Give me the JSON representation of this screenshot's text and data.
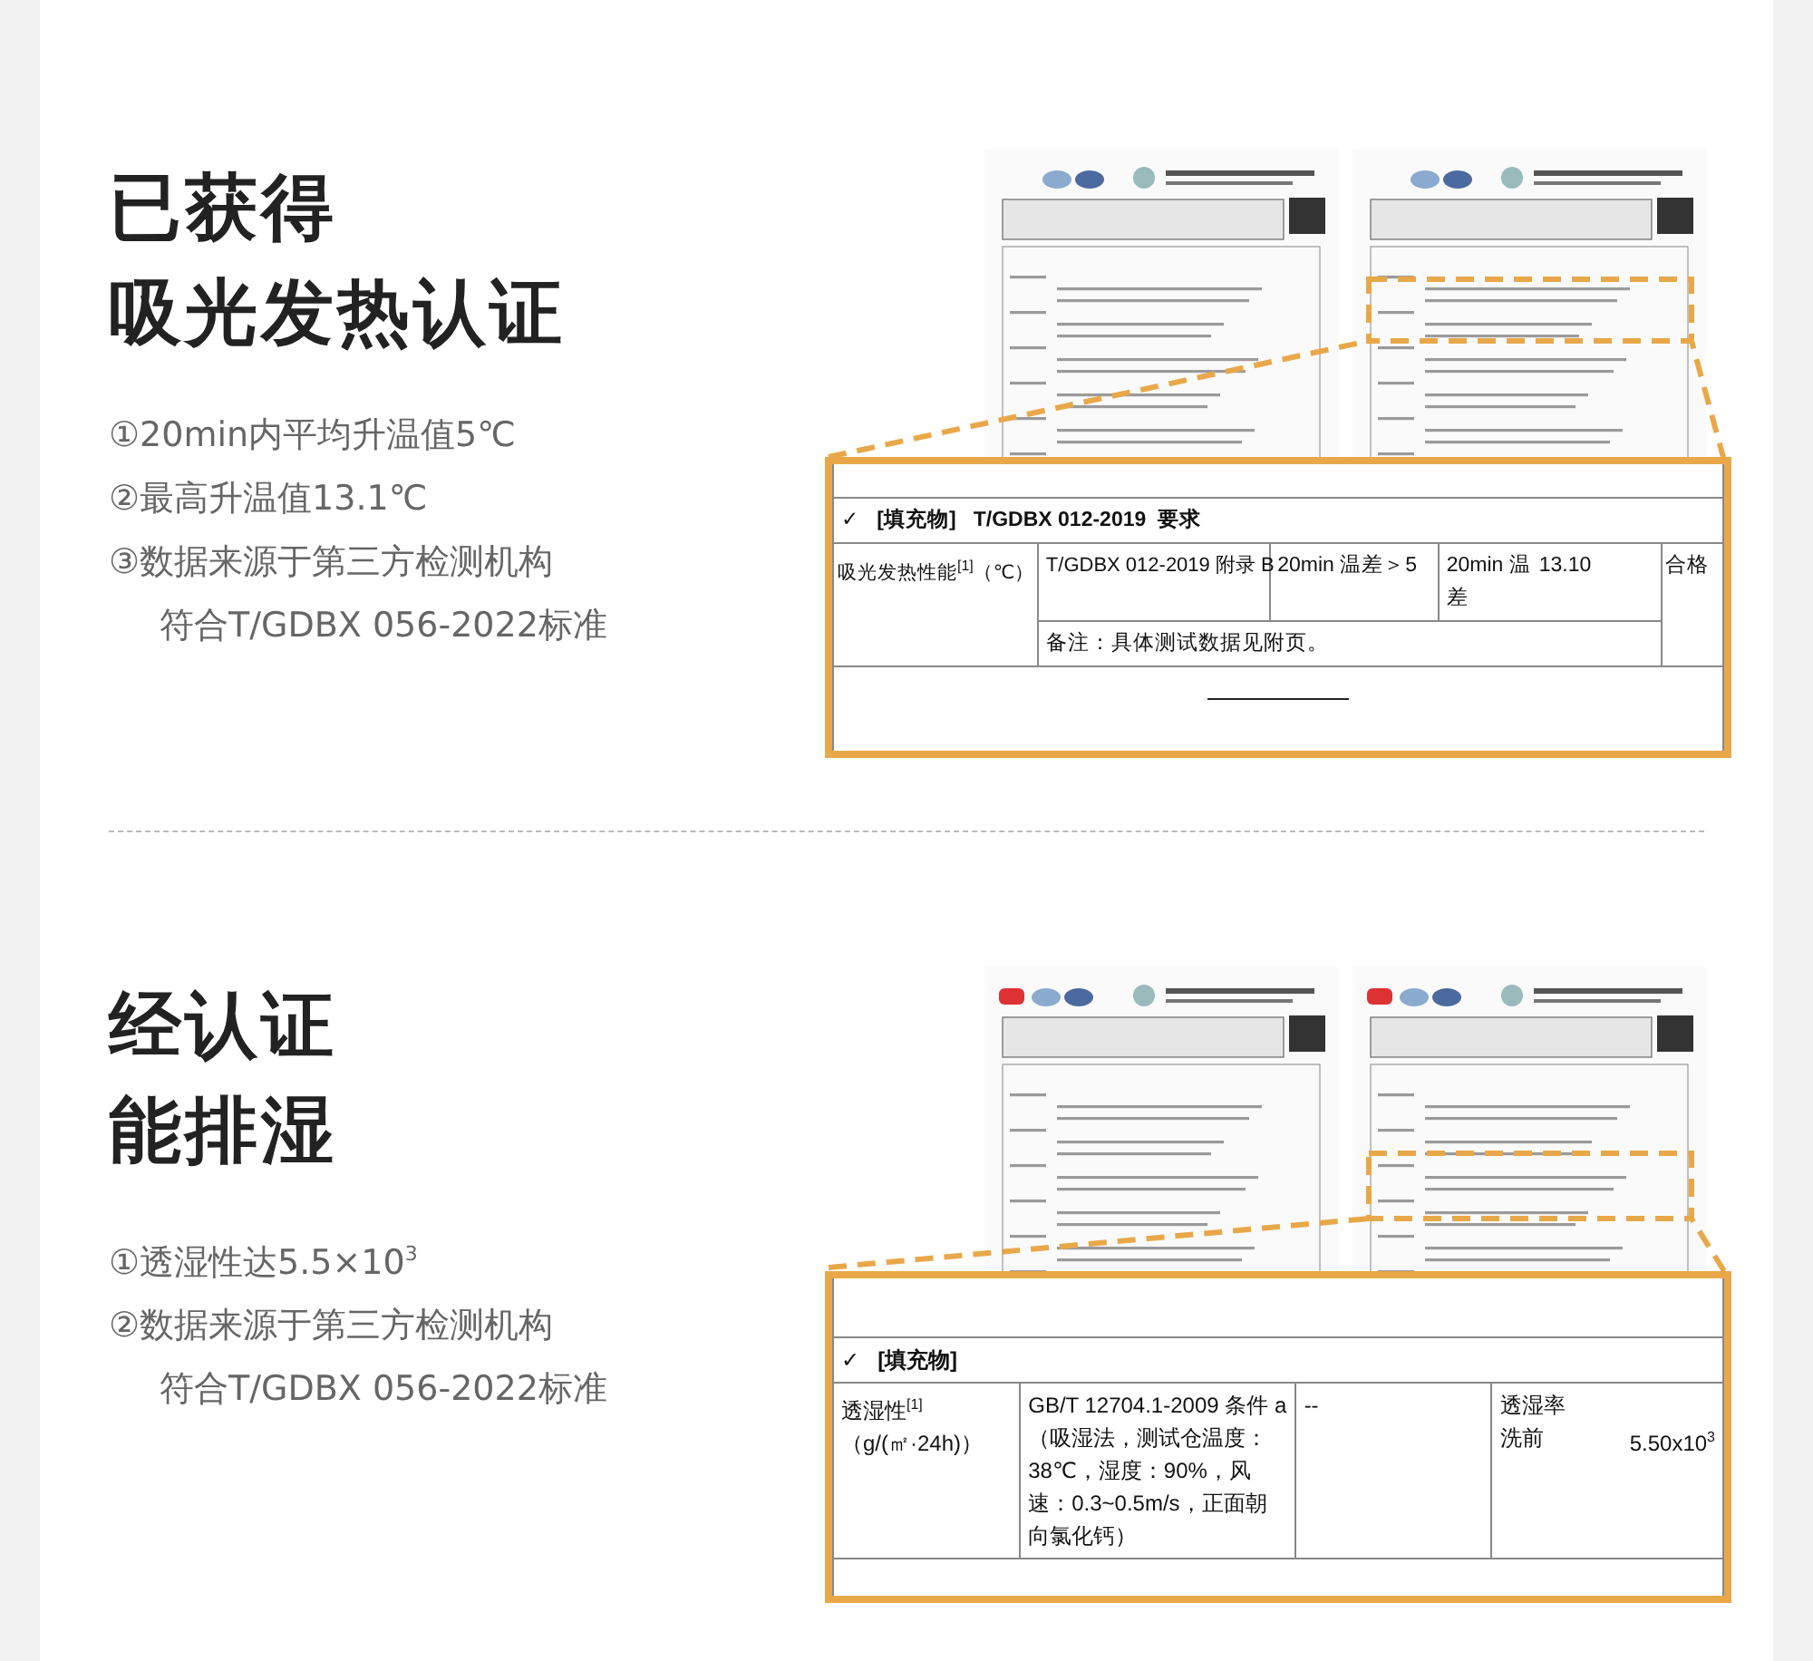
{
  "sections": [
    {
      "title_lines": [
        "已获得",
        "吸光发热认证"
      ],
      "points": [
        {
          "text": "①20min内平均升温值5℃",
          "indent": false
        },
        {
          "text": "②最高升温值13.1℃",
          "indent": false
        },
        {
          "text": "③数据来源于第三方检测机构",
          "indent": false
        },
        {
          "text": "符合T/GDBX 056-2022标准",
          "indent": true
        }
      ],
      "documents": [
        {
          "kind": "picture",
          "red_logo": false
        },
        {
          "kind": "picture",
          "red_logo": false
        }
      ],
      "report": {
        "kind": "heat",
        "check": "✓",
        "heading": "[填充物]   T/GDBX 012-2019  要求",
        "item": "吸光发热性能$^{[1]}$（℃）",
        "method": "T/GDBX 012-2019  附录 B",
        "requirement": "20min 温差＞5",
        "result_label": "20min 温差",
        "result_value": "13.10",
        "verdict": "合格",
        "note": "备注：具体测试数据见附页。"
      }
    },
    {
      "title_lines": [
        "经认证",
        "能排湿"
      ],
      "points": [
        {
          "text": "①透湿性达5.5×10$^{3}$",
          "indent": false
        },
        {
          "text": "②数据来源于第三方检测机构",
          "indent": false
        },
        {
          "text": "符合T/GDBX 056-2022标准",
          "indent": true
        }
      ],
      "documents": [
        {
          "kind": "picture",
          "red_logo": true
        },
        {
          "kind": "picture",
          "red_logo": true
        }
      ],
      "report": {
        "kind": "moisture",
        "check": "✓",
        "heading": "[填充物]",
        "item": "透湿性$^{[1]}$",
        "unit": "（g/(㎡·24h)）",
        "method": "GB/T 12704.1-2009  条件 a（吸湿法，测试仓温度：38℃，湿度：90%，风速：0.3~0.5m/s，正面朝向氯化钙）",
        "requirement": "--",
        "result_label": "透湿率",
        "result_sublabel": "洗前",
        "result_value": "5.50x10$^{3}$"
      }
    }
  ]
}
